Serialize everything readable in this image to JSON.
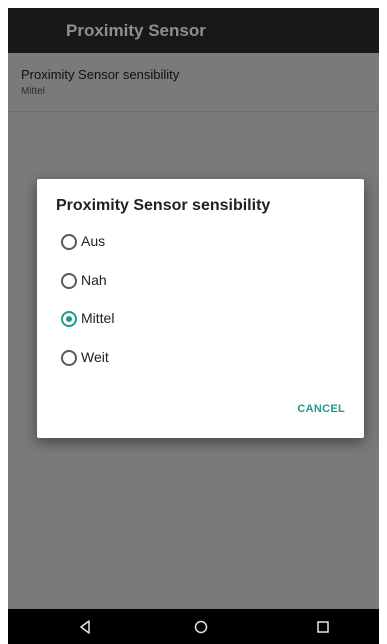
{
  "app_bar": {
    "title": "Proximity Sensor"
  },
  "preference": {
    "title": "Proximity Sensor sensibility",
    "summary": "Mittel"
  },
  "dialog": {
    "title": "Proximity Sensor sensibility",
    "options": [
      {
        "label": "Aus",
        "selected": false
      },
      {
        "label": "Nah",
        "selected": false
      },
      {
        "label": "Mittel",
        "selected": true
      },
      {
        "label": "Weit",
        "selected": false
      }
    ],
    "cancel_label": "CANCEL"
  },
  "nav_bar": {
    "icons": [
      "back-icon",
      "home-icon",
      "recents-icon"
    ]
  },
  "colors": {
    "accent": "#1e9b8c",
    "app_bar": "#181818",
    "scrim": "#7a7a7a",
    "nav_bar": "#000000"
  }
}
